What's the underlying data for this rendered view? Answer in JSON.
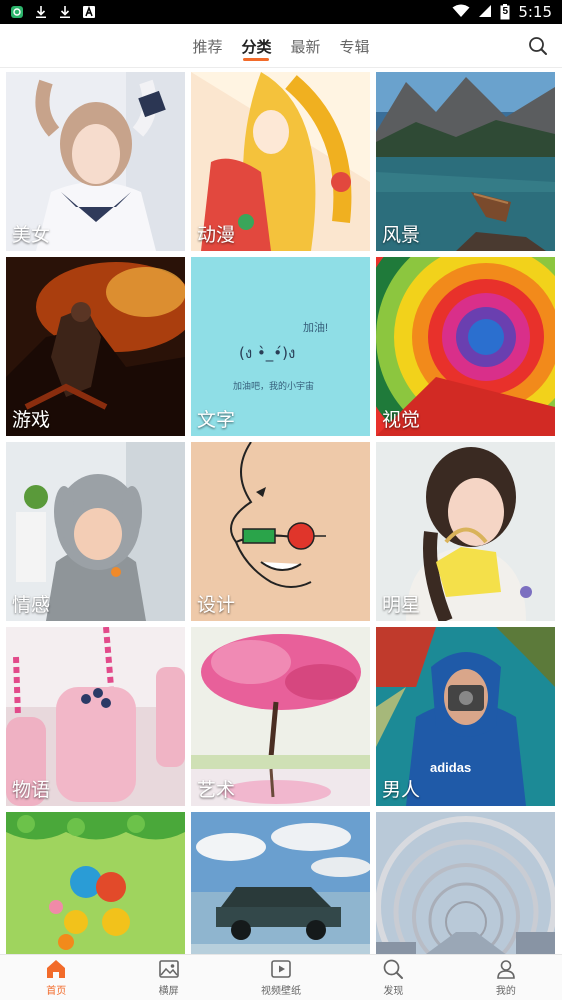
{
  "status_bar": {
    "time": "5:15",
    "battery_level": "5"
  },
  "tabs": [
    {
      "label": "推荐",
      "active": false
    },
    {
      "label": "分类",
      "active": true
    },
    {
      "label": "最新",
      "active": false
    },
    {
      "label": "专辑",
      "active": false
    }
  ],
  "categories": [
    {
      "label": "美女"
    },
    {
      "label": "动漫"
    },
    {
      "label": "风景"
    },
    {
      "label": "游戏"
    },
    {
      "label": "文字"
    },
    {
      "label": "视觉"
    },
    {
      "label": "情感"
    },
    {
      "label": "设计"
    },
    {
      "label": "明星"
    },
    {
      "label": "物语"
    },
    {
      "label": "艺术"
    },
    {
      "label": "男人"
    },
    {
      "label": ""
    },
    {
      "label": ""
    },
    {
      "label": ""
    }
  ],
  "text_tile": {
    "line1": "加油!",
    "line2": "(ง •̀_•́)ง",
    "line3": "加油吧，我的小宇宙"
  },
  "tshirt_text": "adidas",
  "bottom_nav": [
    {
      "label": "首页",
      "icon": "home-icon",
      "active": true
    },
    {
      "label": "横屏",
      "icon": "image-icon",
      "active": false
    },
    {
      "label": "视频壁纸",
      "icon": "video-icon",
      "active": false
    },
    {
      "label": "发现",
      "icon": "search-icon",
      "active": false
    },
    {
      "label": "我的",
      "icon": "user-icon",
      "active": false
    }
  ],
  "colors": {
    "accent": "#f26b2a"
  }
}
